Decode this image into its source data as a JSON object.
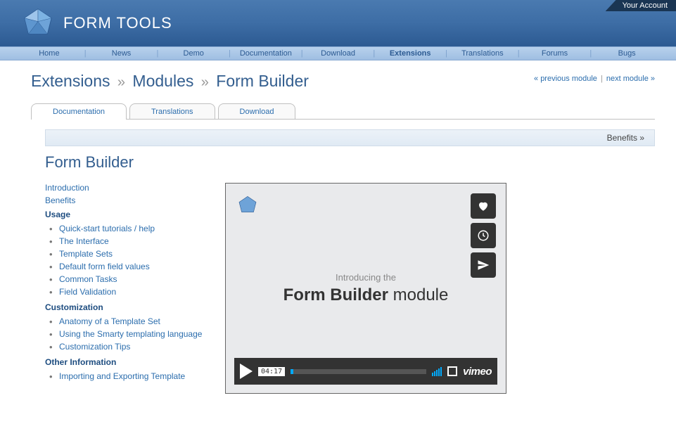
{
  "account": "Your Account",
  "brand": "FORM TOOLS",
  "mainnav": [
    "Home",
    "News",
    "Demo",
    "Documentation",
    "Download",
    "Extensions",
    "Translations",
    "Forums",
    "Bugs"
  ],
  "mainnav_active": "Extensions",
  "nav_prev": "« previous module",
  "nav_next": "next module »",
  "breadcrumb": [
    "Extensions",
    "Modules",
    "Form Builder"
  ],
  "tabs": {
    "doc": "Documentation",
    "trans": "Translations",
    "dl": "Download"
  },
  "bar": "Benefits »",
  "heading": "Form Builder",
  "sidebar": {
    "intro": "Introduction",
    "benefits": "Benefits",
    "usage_head": "Usage",
    "usage": [
      "Quick-start tutorials / help",
      "The Interface",
      "Template Sets",
      "Default form field values",
      "Common Tasks",
      "Field Validation"
    ],
    "cust_head": "Customization",
    "cust": [
      "Anatomy of a Template Set",
      "Using the Smarty templating language",
      "Customization Tips"
    ],
    "other_head": "Other Information",
    "other": [
      "Importing and Exporting Template"
    ]
  },
  "video": {
    "intro": "Introducing the",
    "title_bold": "Form Builder",
    "title_rest": " module",
    "time": "04:17",
    "provider": "vimeo"
  }
}
